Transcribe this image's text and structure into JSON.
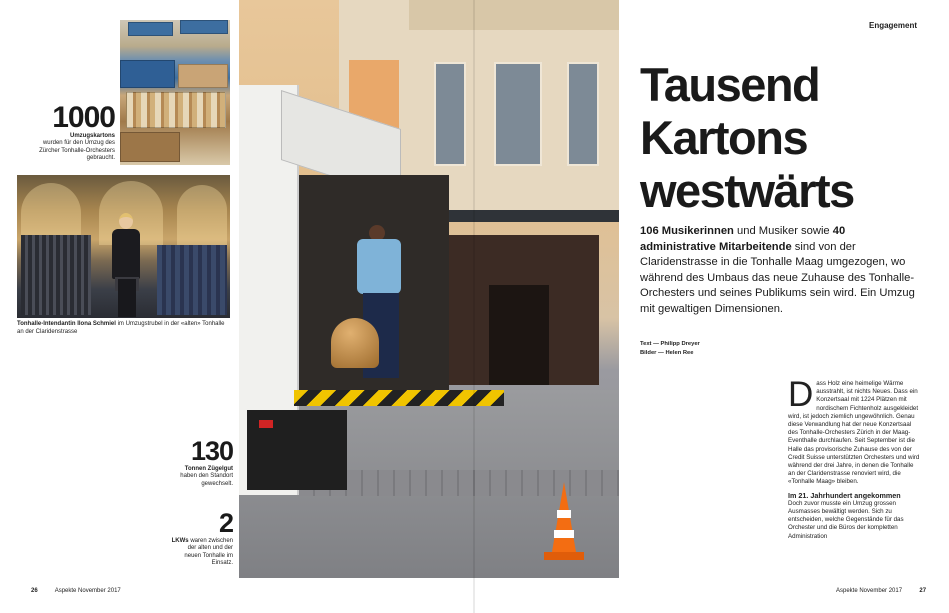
{
  "left_page": {
    "stats": [
      {
        "number": "1000",
        "label_bold": "Umzugskartons",
        "label_rest": "wurden für den Umzug des Zürcher Tonhalle-Orchesters gebraucht."
      },
      {
        "number": "130",
        "label_bold": "Tonnen Zügelgut",
        "label_rest": "haben den Standort gewechselt."
      },
      {
        "number": "2",
        "label_bold": "LKWs",
        "label_rest": "waren zwischen der alten und der neuen Tonhalle im Einsatz."
      }
    ],
    "caption_bold": "Tonhalle-Intendantin Ilona Schmiel",
    "caption_rest": " im Umzugstrubel in der «alten» Tonhalle an der Claridenstrasse",
    "folio_number": "26",
    "folio_title": "Aspekte November 2017"
  },
  "right_page": {
    "section_label": "Engagement",
    "headline_lines": [
      "Tausend",
      "Kartons",
      "westwärts"
    ],
    "lead_bold_1": "106 Musikerinnen",
    "lead_text_1": " und Musiker sowie ",
    "lead_bold_2": "40 administrative Mitarbeitende",
    "lead_text_2": " sind von der Claridenstrasse in die Tonhalle Maag umgezogen, wo während des Umbaus das neue Zuhause des Tonhalle-Orchesters und seines Publikums sein wird. Ein Umzug mit gewaltigen Dimensionen.",
    "credit_text": "Text — Philipp Dreyer",
    "credit_images": "Bilder — Helen Ree",
    "body_dropcap": "D",
    "body_paragraph": "ass Holz eine heimelige Wärme ausstrahlt, ist nichts Neues. Dass ein Konzertsaal mit 1224 Plätzen mit nordischem Fichtenholz ausgekleidet wird, ist jedoch ziemlich ungewöhnlich. Genau diese Verwandlung hat der neue Konzertsaal des Tonhalle-Orchesters Zürich in der Maag-Eventhalle durchlaufen. Seit September ist die Halle das provisorische Zuhause des von der Credit Suisse unterstützten Orchesters und wird während der drei Jahre, in denen die Tonhalle an der Claridenstrasse renoviert wird, die «Tonhalle Maag» bleiben.",
    "body_subhead": "Im 21. Jahrhundert angekommen",
    "body_paragraph_2": "Doch zuvor musste ein Umzug grossen Ausmasses bewältigt werden. Sich zu entscheiden, welche Gegenstände für das Orchester und die Büros der kompletten Administration",
    "folio_title": "Aspekte November 2017",
    "folio_number": "27"
  }
}
